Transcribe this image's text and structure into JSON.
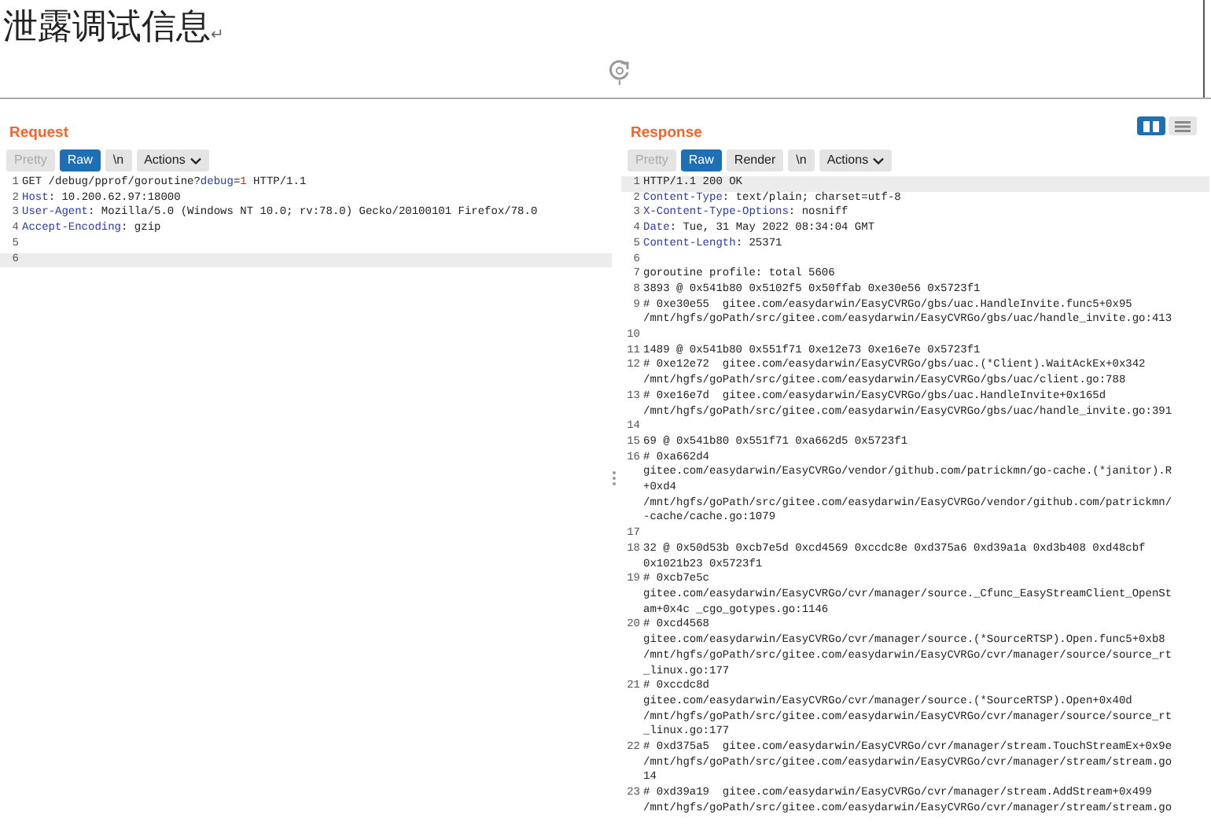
{
  "document": {
    "heading": "泄露调试信息",
    "paragraph_mark": "↵"
  },
  "request": {
    "title": "Request",
    "tabs": [
      {
        "label": "Pretty",
        "selected": false,
        "disabled": true
      },
      {
        "label": "Raw",
        "selected": true,
        "disabled": false
      },
      {
        "label": "\\n",
        "selected": false,
        "disabled": false
      }
    ],
    "actions": "Actions",
    "lines": [
      {
        "number": "1",
        "kind": "request",
        "current": false,
        "parts": [
          {
            "text": "GET /debug/pprof/goroutine?",
            "kind": "plain"
          },
          {
            "text": "debug",
            "kind": "param"
          },
          {
            "text": "=",
            "kind": "plain"
          },
          {
            "text": "1",
            "kind": "value"
          },
          {
            "text": " HTTP/1.1",
            "kind": "plain"
          }
        ]
      },
      {
        "number": "2",
        "kind": "header",
        "current": false,
        "key": "Host",
        "value": ": 10.200.62.97:18000"
      },
      {
        "number": "3",
        "kind": "header",
        "current": false,
        "key": "User-Agent",
        "value": ": Mozilla/5.0 (Windows NT 10.0; rv:78.0) Gecko/20100101 Firefox/78.0"
      },
      {
        "number": "4",
        "kind": "header",
        "current": false,
        "key": "Accept-Encoding",
        "value": ": gzip"
      },
      {
        "number": "5",
        "kind": "plain",
        "current": false
      },
      {
        "number": "6",
        "kind": "plain",
        "current": true
      }
    ]
  },
  "response": {
    "title": "Response",
    "view_toggle": [
      {
        "selected": true
      },
      {
        "selected": false
      }
    ],
    "tabs": [
      {
        "label": "Pretty",
        "selected": false,
        "disabled": true
      },
      {
        "label": "Raw",
        "selected": true,
        "disabled": false
      },
      {
        "label": "Render",
        "selected": false,
        "disabled": false
      },
      {
        "label": "\\n",
        "selected": false,
        "disabled": false
      }
    ],
    "actions": "Actions",
    "lines": [
      {
        "number": "1",
        "kind": "plain",
        "current": true,
        "rows": [
          "HTTP/1.1 200 OK"
        ]
      },
      {
        "number": "2",
        "kind": "header",
        "current": false,
        "key": "Content-Type",
        "value": ": text/plain; charset=utf-8"
      },
      {
        "number": "3",
        "kind": "header",
        "current": false,
        "key": "X-Content-Type-Options",
        "value": ": nosniff"
      },
      {
        "number": "4",
        "kind": "header",
        "current": false,
        "key": "Date",
        "value": ": Tue, 31 May 2022 08:34:04 GMT"
      },
      {
        "number": "5",
        "kind": "header",
        "current": false,
        "key": "Content-Length",
        "value": ": 25371"
      },
      {
        "number": "6",
        "kind": "plain",
        "current": false
      },
      {
        "number": "7",
        "kind": "plain",
        "current": false,
        "rows": [
          "goroutine profile: total 5606"
        ]
      },
      {
        "number": "8",
        "kind": "plain",
        "current": false,
        "rows": [
          "3893 @ 0x541b80 0x5102f5 0x50ffab 0xe30e56 0x5723f1"
        ]
      },
      {
        "number": "9",
        "kind": "plain",
        "current": false,
        "rows": [
          "# 0xe30e55  gitee.com/easydarwin/EasyCVRGo/gbs/uac.HandleInvite.func5+0x95",
          "/mnt/hgfs/goPath/src/gitee.com/easydarwin/EasyCVRGo/gbs/uac/handle_invite.go:413"
        ]
      },
      {
        "number": "10",
        "kind": "plain",
        "current": false
      },
      {
        "number": "11",
        "kind": "plain",
        "current": false,
        "rows": [
          "1489 @ 0x541b80 0x551f71 0xe12e73 0xe16e7e 0x5723f1"
        ]
      },
      {
        "number": "12",
        "kind": "plain",
        "current": false,
        "rows": [
          "# 0xe12e72  gitee.com/easydarwin/EasyCVRGo/gbs/uac.(*Client).WaitAckEx+0x342",
          "/mnt/hgfs/goPath/src/gitee.com/easydarwin/EasyCVRGo/gbs/uac/client.go:788"
        ]
      },
      {
        "number": "13",
        "kind": "plain",
        "current": false,
        "rows": [
          "# 0xe16e7d  gitee.com/easydarwin/EasyCVRGo/gbs/uac.HandleInvite+0x165d",
          "/mnt/hgfs/goPath/src/gitee.com/easydarwin/EasyCVRGo/gbs/uac/handle_invite.go:391"
        ]
      },
      {
        "number": "14",
        "kind": "plain",
        "current": false
      },
      {
        "number": "15",
        "kind": "plain",
        "current": false,
        "rows": [
          "69 @ 0x541b80 0x551f71 0xa662d5 0x5723f1"
        ]
      },
      {
        "number": "16",
        "kind": "plain",
        "current": false,
        "rows": [
          "# 0xa662d4",
          "gitee.com/easydarwin/EasyCVRGo/vendor/github.com/patrickmn/go-cache.(*janitor).R",
          "+0xd4",
          "/mnt/hgfs/goPath/src/gitee.com/easydarwin/EasyCVRGo/vendor/github.com/patrickmn/",
          "-cache/cache.go:1079"
        ]
      },
      {
        "number": "17",
        "kind": "plain",
        "current": false
      },
      {
        "number": "18",
        "kind": "plain",
        "current": false,
        "rows": [
          "32 @ 0x50d53b 0xcb7e5d 0xcd4569 0xccdc8e 0xd375a6 0xd39a1a 0xd3b408 0xd48cbf",
          "0x1021b23 0x5723f1"
        ]
      },
      {
        "number": "19",
        "kind": "plain",
        "current": false,
        "rows": [
          "# 0xcb7e5c",
          "gitee.com/easydarwin/EasyCVRGo/cvr/manager/source._Cfunc_EasyStreamClient_OpenSt",
          "am+0x4c _cgo_gotypes.go:1146"
        ]
      },
      {
        "number": "20",
        "kind": "plain",
        "current": false,
        "rows": [
          "# 0xcd4568",
          "gitee.com/easydarwin/EasyCVRGo/cvr/manager/source.(*SourceRTSP).Open.func5+0xb8",
          "/mnt/hgfs/goPath/src/gitee.com/easydarwin/EasyCVRGo/cvr/manager/source/source_rt",
          "_linux.go:177"
        ]
      },
      {
        "number": "21",
        "kind": "plain",
        "current": false,
        "rows": [
          "# 0xccdc8d",
          "gitee.com/easydarwin/EasyCVRGo/cvr/manager/source.(*SourceRTSP).Open+0x40d",
          "/mnt/hgfs/goPath/src/gitee.com/easydarwin/EasyCVRGo/cvr/manager/source/source_rt",
          "_linux.go:177"
        ]
      },
      {
        "number": "22",
        "kind": "plain",
        "current": false,
        "rows": [
          "# 0xd375a5  gitee.com/easydarwin/EasyCVRGo/cvr/manager/stream.TouchStreamEx+0x9e",
          "/mnt/hgfs/goPath/src/gitee.com/easydarwin/EasyCVRGo/cvr/manager/stream/stream.go",
          "14"
        ]
      },
      {
        "number": "23",
        "kind": "plain",
        "current": false,
        "rows": [
          "# 0xd39a19  gitee.com/easydarwin/EasyCVRGo/cvr/manager/stream.AddStream+0x499",
          "/mnt/hgfs/goPath/src/gitee.com/easydarwin/EasyCVRGo/cvr/manager/stream/stream.go"
        ]
      }
    ]
  }
}
